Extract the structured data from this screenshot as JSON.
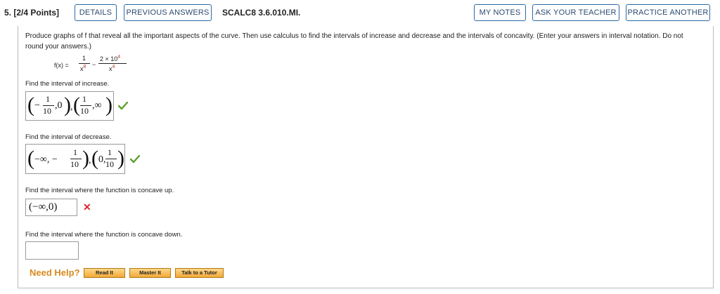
{
  "header": {
    "question_number": "5.",
    "points": "[2/4 Points]",
    "details_label": "DETAILS",
    "previous_answers_label": "PREVIOUS ANSWERS",
    "question_id": "SCALC8 3.6.010.MI.",
    "my_notes_label": "MY NOTES",
    "ask_teacher_label": "ASK YOUR TEACHER",
    "practice_another_label": "PRACTICE ANOTHER",
    "accent_color": "#2a6aa8"
  },
  "problem": {
    "prompt": "Produce graphs of f that reveal all the important aspects of the curve. Then use calculus to find the intervals of increase and decrease and the intervals of concavity. (Enter your answers in interval notation. Do not round your answers.)",
    "function_lhs": "f(x) =",
    "term1_num": "1",
    "term1_den_base": "x",
    "term1_den_exp": "8",
    "minus": "−",
    "term2_num_base": "2 × 10",
    "term2_num_exp": "4",
    "term2_den_base": "x",
    "term2_den_exp": "4"
  },
  "questions": [
    {
      "label": "Find the interval of increase.",
      "status": "correct",
      "status_icon": "check-icon",
      "answer": {
        "p1_open": "(",
        "p1_sign": "−",
        "p1_num": "1",
        "p1_den": "10",
        "p1_rest": ",0",
        "p1_close": ")",
        "union": ",",
        "p2_open": "(",
        "p2_num": "1",
        "p2_den": "10",
        "p2_rest": ",∞",
        "p2_close": ")"
      }
    },
    {
      "label": "Find the interval of decrease.",
      "status": "correct",
      "status_icon": "check-icon",
      "answer": {
        "p1_open": "(",
        "p1_lead": "−∞, −",
        "p1_num": "1",
        "p1_den": "10",
        "p1_close": ")",
        "union": ",",
        "p2_open": "(",
        "p2_lead": "0,",
        "p2_num": "1",
        "p2_den": "10",
        "p2_close": ")"
      }
    },
    {
      "label": "Find the interval where the function is concave up.",
      "status": "incorrect",
      "status_icon": "cross-icon",
      "answer": {
        "text": "(−∞,0)",
        "cross": "✕"
      }
    },
    {
      "label": "Find the interval where the function is concave down.",
      "status": "blank",
      "answer": {
        "text": ""
      }
    }
  ],
  "help": {
    "need_help": "Need Help?",
    "read_it": "Read It",
    "master_it": "Master It",
    "talk_to_tutor": "Talk to a Tutor",
    "color": "#d98a1e"
  },
  "colors": {
    "correct": "#5aa02c",
    "incorrect": "#d9272e"
  }
}
